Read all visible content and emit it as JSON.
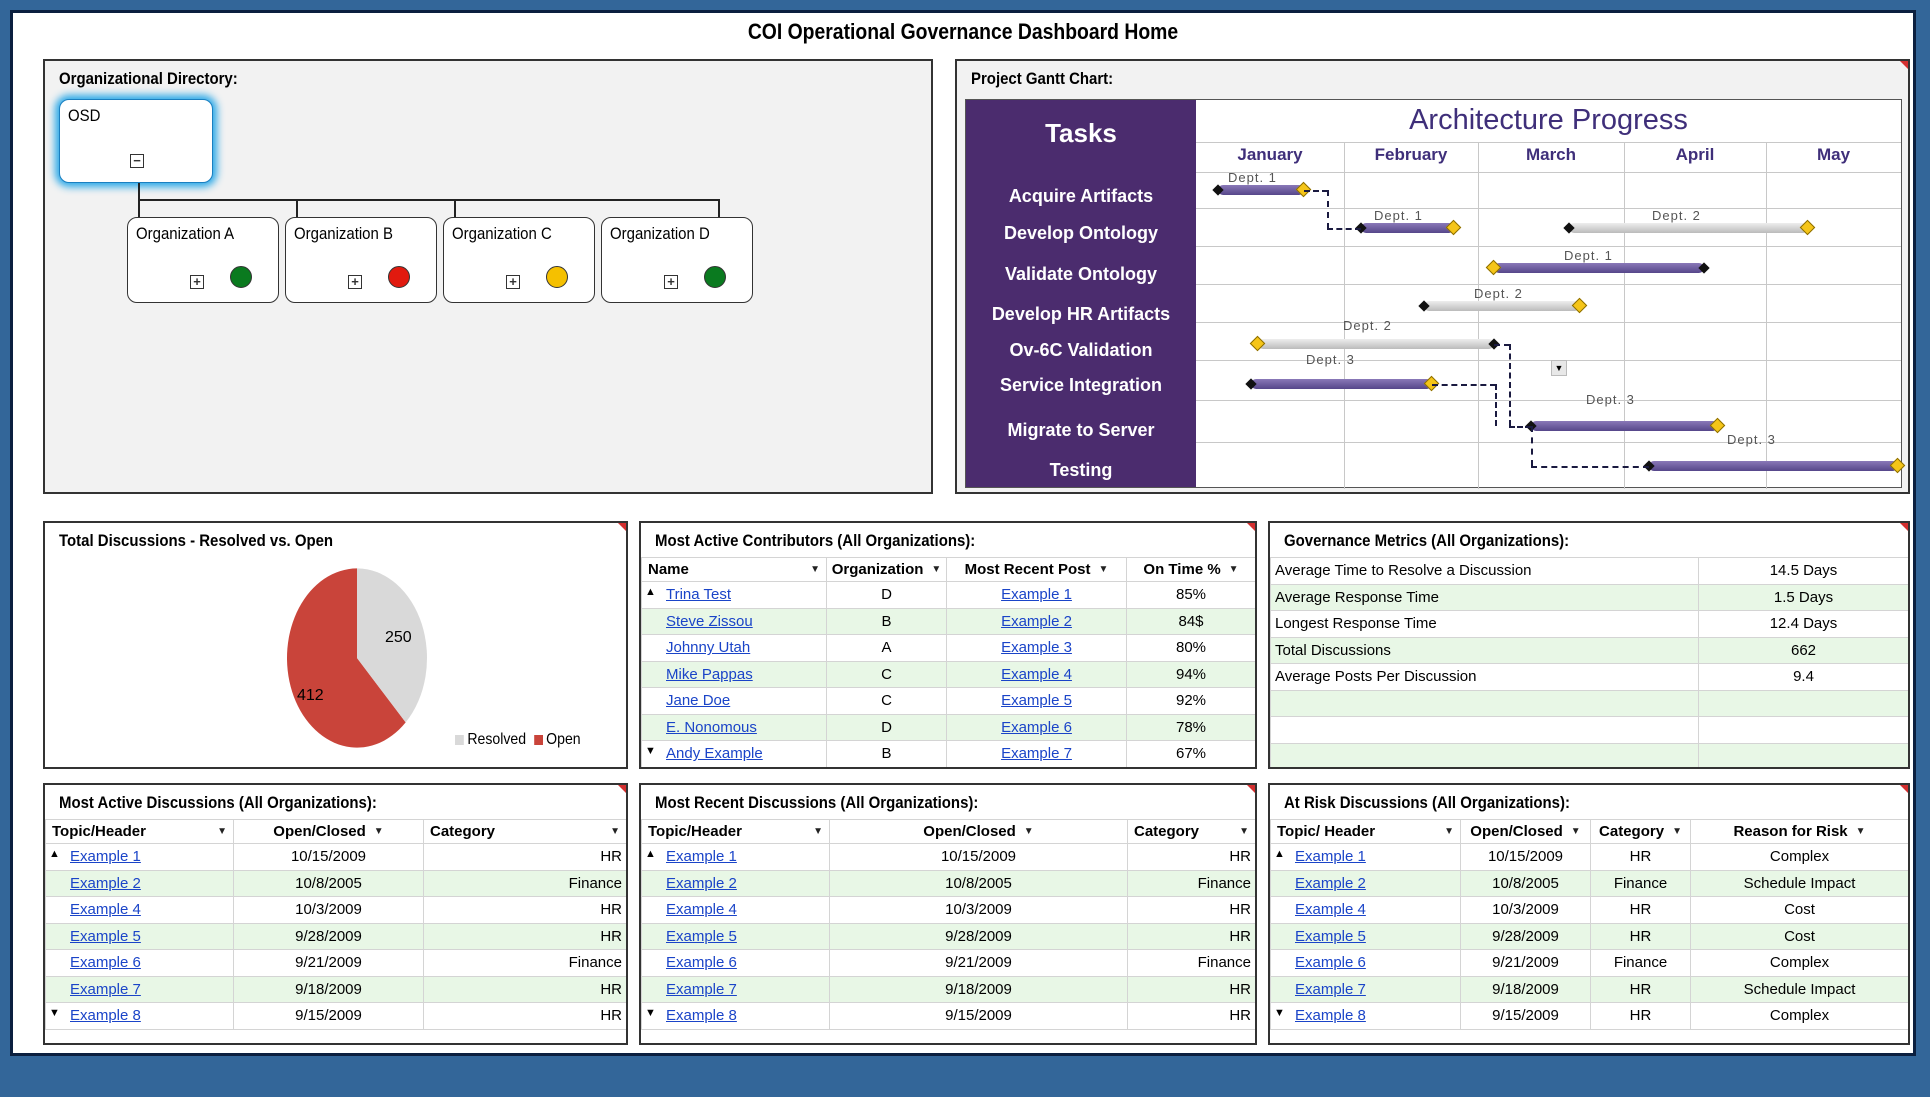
{
  "page_title": "COI Operational Governance Dashboard Home",
  "org_directory": {
    "title": "Organizational Directory:",
    "root": {
      "label": "OSD",
      "toggle": "⊟"
    },
    "orgs": [
      {
        "label": "Organization A",
        "status_color": "#0a7a1f"
      },
      {
        "label": "Organization B",
        "status_color": "#e11a0f"
      },
      {
        "label": "Organization C",
        "status_color": "#f5c000"
      },
      {
        "label": "Organization D",
        "status_color": "#0a7a1f"
      }
    ],
    "expand_glyph": "⊞"
  },
  "gantt": {
    "panel_title": "Project Gantt Chart:",
    "tasks_header": "Tasks",
    "chart_title": "Architecture Progress",
    "months": [
      "January",
      "February",
      "March",
      "April",
      "May"
    ],
    "tasks": [
      "Acquire Artifacts",
      "Develop Ontology",
      "Validate Ontology",
      "Develop HR Artifacts",
      "Ov-6C Validation",
      "Service Integration",
      "Migrate to Server",
      "Testing"
    ],
    "dept_labels": [
      "Dept. 1",
      "Dept. 1",
      "Dept. 2",
      "Dept. 1",
      "Dept. 2",
      "Dept. 2",
      "Dept. 3",
      "Dept. 3",
      "Dept. 3"
    ],
    "colors": {
      "tasks_bg": "#4b2c6e",
      "bar_purple": "#56478a",
      "bar_gray": "#bbbbbb",
      "milestone": "#f5c518"
    }
  },
  "pie": {
    "title": "Total Discussions - Resolved vs. Open",
    "resolved_value": "250",
    "open_value": "412",
    "resolved_label": "Resolved",
    "open_label": "Open",
    "resolved_color": "#d9d9d9",
    "open_color": "#c9443a"
  },
  "contributors": {
    "title": "Most Active Contributors (All Organizations):",
    "columns": [
      "Name",
      "Organization",
      "Most Recent Post",
      "On Time %"
    ],
    "rows": [
      [
        "Trina Test",
        "D",
        "Example 1",
        "85%"
      ],
      [
        "Steve Zissou",
        "B",
        "Example 2",
        "84$"
      ],
      [
        "Johnny Utah",
        "A",
        "Example 3",
        "80%"
      ],
      [
        "Mike Pappas",
        "C",
        "Example 4",
        "94%"
      ],
      [
        "Jane Doe",
        "C",
        "Example 5",
        "92%"
      ],
      [
        "E. Nonomous",
        "D",
        "Example 6",
        "78%"
      ],
      [
        "Andy Example",
        "B",
        "Example 7",
        "67%"
      ]
    ]
  },
  "metrics": {
    "title": "Governance Metrics (All Organizations):",
    "rows": [
      [
        "Average Time to Resolve a Discussion",
        "14.5 Days"
      ],
      [
        "Average Response Time",
        "1.5 Days"
      ],
      [
        "Longest Response Time",
        "12.4 Days"
      ],
      [
        "Total Discussions",
        "662"
      ],
      [
        "Average Posts Per Discussion",
        "9.4"
      ],
      [
        "",
        ""
      ],
      [
        "",
        ""
      ],
      [
        "",
        ""
      ]
    ]
  },
  "active_discussions": {
    "title": "Most Active Discussions (All Organizations):",
    "columns": [
      "Topic/Header",
      "Open/Closed",
      "Category"
    ],
    "rows": [
      [
        "Example 1",
        "10/15/2009",
        "HR"
      ],
      [
        "Example 2",
        "10/8/2005",
        "Finance"
      ],
      [
        "Example 4",
        "10/3/2009",
        "HR"
      ],
      [
        "Example 5",
        "9/28/2009",
        "HR"
      ],
      [
        "Example 6",
        "9/21/2009",
        "Finance"
      ],
      [
        "Example 7",
        "9/18/2009",
        "HR"
      ],
      [
        "Example 8",
        "9/15/2009",
        "HR"
      ]
    ]
  },
  "recent_discussions": {
    "title": "Most Recent Discussions (All Organizations):",
    "columns": [
      "Topic/Header",
      "Open/Closed",
      "Category"
    ],
    "rows": [
      [
        "Example 1",
        "10/15/2009",
        "HR"
      ],
      [
        "Example 2",
        "10/8/2005",
        "Finance"
      ],
      [
        "Example 4",
        "10/3/2009",
        "HR"
      ],
      [
        "Example 5",
        "9/28/2009",
        "HR"
      ],
      [
        "Example 6",
        "9/21/2009",
        "Finance"
      ],
      [
        "Example 7",
        "9/18/2009",
        "HR"
      ],
      [
        "Example 8",
        "9/15/2009",
        "HR"
      ]
    ]
  },
  "at_risk": {
    "title": "At Risk Discussions (All Organizations):",
    "columns": [
      "Topic/ Header",
      "Open/Closed",
      "Category",
      "Reason for Risk"
    ],
    "rows": [
      [
        "Example 1",
        "10/15/2009",
        "HR",
        "Complex"
      ],
      [
        "Example 2",
        "10/8/2005",
        "Finance",
        "Schedule Impact"
      ],
      [
        "Example 4",
        "10/3/2009",
        "HR",
        "Cost"
      ],
      [
        "Example 5",
        "9/28/2009",
        "HR",
        "Cost"
      ],
      [
        "Example 6",
        "9/21/2009",
        "Finance",
        "Complex"
      ],
      [
        "Example 7",
        "9/18/2009",
        "HR",
        "Schedule Impact"
      ],
      [
        "Example 8",
        "9/15/2009",
        "HR",
        "Complex"
      ]
    ]
  },
  "icons": {
    "dropdown": "dropdown-arrow-icon",
    "scroll_up": "scroll-up-icon",
    "scroll_down": "scroll-down-icon"
  }
}
